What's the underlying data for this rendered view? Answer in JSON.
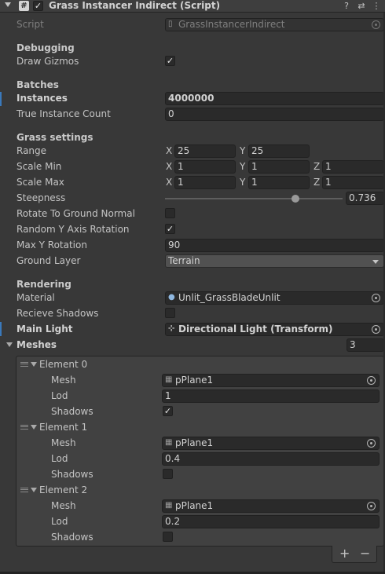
{
  "header": {
    "title": "Grass Instancer Indirect (Script)",
    "script_icon": "#",
    "enabled_check": "✓",
    "help_icon": "?",
    "preset_icon": "⇄",
    "menu_icon": "⋮"
  },
  "script": {
    "label": "Script",
    "value": "GrassInstancerIndirect"
  },
  "debugging": {
    "heading": "Debugging",
    "draw_gizmos": {
      "label": "Draw Gizmos",
      "checked": "✓"
    }
  },
  "batches": {
    "heading": "Batches",
    "instances": {
      "label": "Instances",
      "value": "4000000"
    },
    "true_instance_count": {
      "label": "True Instance Count",
      "value": "0"
    }
  },
  "grass_settings": {
    "heading": "Grass settings",
    "range": {
      "label": "Range",
      "x_label": "X",
      "x": "25",
      "y_label": "Y",
      "y": "25"
    },
    "scale_min": {
      "label": "Scale Min",
      "x_label": "X",
      "x": "1",
      "y_label": "Y",
      "y": "1",
      "z_label": "Z",
      "z": "1"
    },
    "scale_max": {
      "label": "Scale Max",
      "x_label": "X",
      "x": "1",
      "y_label": "Y",
      "y": "1",
      "z_label": "Z",
      "z": "1"
    },
    "steepness": {
      "label": "Steepness",
      "value": "0.736",
      "fraction": 0.736
    },
    "rotate_to_ground_normal": {
      "label": "Rotate To Ground Normal",
      "checked": ""
    },
    "random_y_axis_rotation": {
      "label": "Random Y Axis Rotation",
      "checked": "✓"
    },
    "max_y_rotation": {
      "label": "Max Y Rotation",
      "value": "90"
    },
    "ground_layer": {
      "label": "Ground Layer",
      "value": "Terrain"
    }
  },
  "rendering": {
    "heading": "Rendering",
    "material": {
      "label": "Material",
      "value": "Unlit_GrassBladeUnlit",
      "icon": "material-icon"
    },
    "recieve_shadows": {
      "label": "Recieve Shadows",
      "checked": ""
    },
    "main_light": {
      "label": "Main Light",
      "value": "Directional Light (Transform)",
      "icon": "transform-icon"
    }
  },
  "meshes": {
    "label": "Meshes",
    "count": "3",
    "elements": [
      {
        "title": "Element 0",
        "mesh_label": "Mesh",
        "mesh": "pPlane1",
        "lod_label": "Lod",
        "lod": "1",
        "shadows_label": "Shadows",
        "shadows": "✓"
      },
      {
        "title": "Element 1",
        "mesh_label": "Mesh",
        "mesh": "pPlane1",
        "lod_label": "Lod",
        "lod": "0.4",
        "shadows_label": "Shadows",
        "shadows": ""
      },
      {
        "title": "Element 2",
        "mesh_label": "Mesh",
        "mesh": "pPlane1",
        "lod_label": "Lod",
        "lod": "0.2",
        "shadows_label": "Shadows",
        "shadows": ""
      }
    ],
    "add_label": "+",
    "remove_label": "−"
  },
  "colors": {
    "background": "#383838",
    "field": "#2a2a2a",
    "accent": "#3a79bb",
    "text": "#c4c4c4"
  }
}
